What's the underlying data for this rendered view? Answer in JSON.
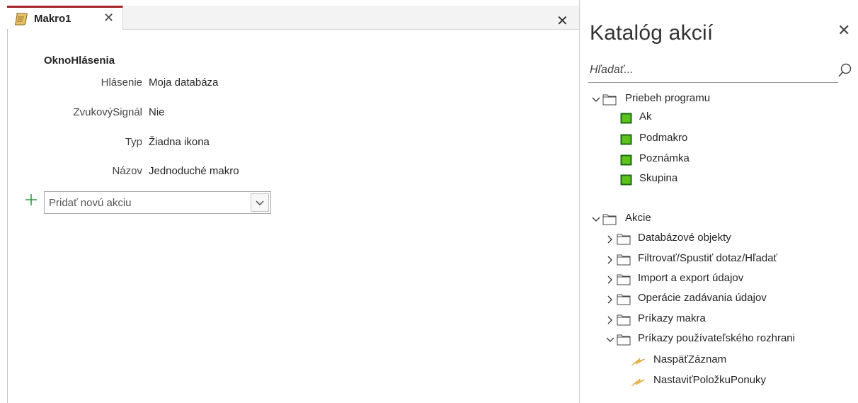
{
  "document": {
    "tab_title": "Makro1",
    "tab_close": "✕",
    "close": "✕"
  },
  "macro": {
    "action_name": "OknoHlásenia",
    "arguments": [
      {
        "label": "Hlásenie",
        "value": "Moja databáza"
      },
      {
        "label": "ZvukovýSignál",
        "value": "Nie"
      },
      {
        "label": "Typ",
        "value": "Žiadna ikona"
      },
      {
        "label": "Názov",
        "value": "Jednoduché makro"
      }
    ],
    "add_action_placeholder": "Pridať novú akciu"
  },
  "catalog": {
    "title": "Katalóg akcií",
    "close": "✕",
    "search_placeholder": "Hľadať...",
    "program_flow": {
      "label": "Priebeh programu",
      "items": [
        "Ak",
        "Podmakro",
        "Poznámka",
        "Skupina"
      ]
    },
    "actions": {
      "label": "Akcie",
      "categories": [
        "Databázové objekty",
        "Filtrovať/Spustiť dotaz/Hľadať",
        "Import a export údajov",
        "Operácie zadávania údajov",
        "Príkazy makra",
        "Príkazy používateľského rozhrani"
      ],
      "ui_commands": [
        "NaspäťZáznam",
        "NastaviťPoložkuPonuky"
      ]
    }
  },
  "colors": {
    "tab_accent": "#a4262c",
    "plus_green": "#2e9e3e",
    "flow_icon_green": "#5cc31a",
    "action_icon_orange": "#f0b848"
  },
  "icons": {
    "tab": "macro-scroll-icon",
    "add": "plus-icon",
    "dropdown": "chevron-down-icon",
    "search": "search-icon",
    "folder": "folder-icon",
    "flow": "program-flow-block-icon",
    "action": "macro-action-bolt-icon"
  }
}
